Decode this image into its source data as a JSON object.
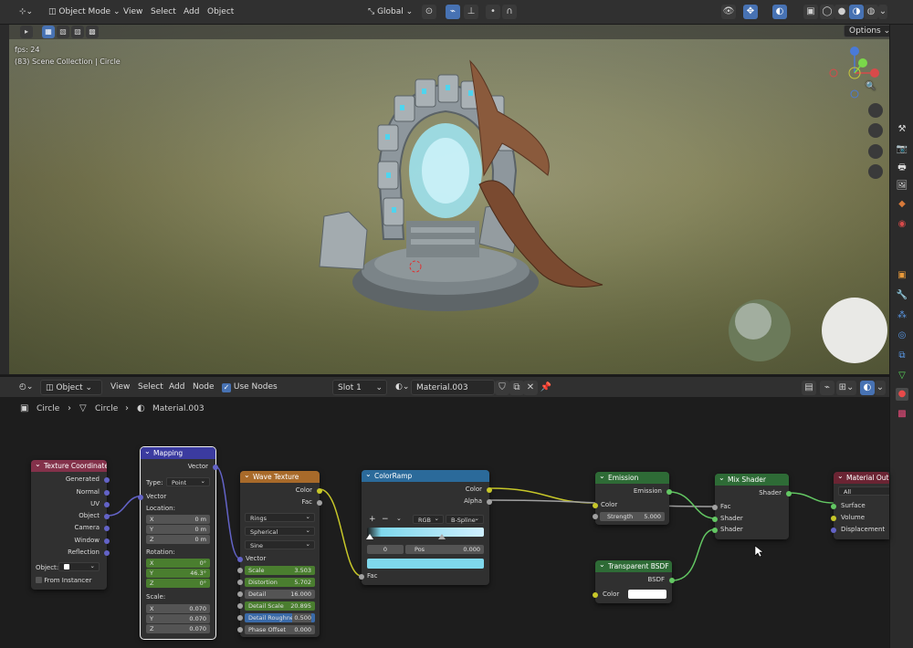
{
  "viewport_header": {
    "mode": "Object Mode",
    "menus": [
      "View",
      "Select",
      "Add",
      "Object"
    ],
    "transform_orientation": "Global",
    "options": "Options"
  },
  "viewport_overlay": {
    "fps": "fps: 24",
    "collection": "(83) Scene Collection | Circle"
  },
  "node_header": {
    "editor_type": "Object",
    "menus": [
      "View",
      "Select",
      "Add",
      "Node"
    ],
    "use_nodes": "Use Nodes",
    "slot": "Slot 1",
    "material": "Material.003"
  },
  "breadcrumb": {
    "object": "Circle",
    "mesh": "Circle",
    "material": "Material.003"
  },
  "nodes": {
    "texcoord": {
      "title": "Texture Coordinate",
      "outputs": [
        "Generated",
        "Normal",
        "UV",
        "Object",
        "Camera",
        "Window",
        "Reflection"
      ],
      "object_label": "Object:",
      "from_instancer": "From Instancer"
    },
    "mapping": {
      "title": "Mapping",
      "output": "Vector",
      "type_label": "Type:",
      "type_value": "Point",
      "input": "Vector",
      "location_label": "Location:",
      "location": [
        {
          "axis": "X",
          "value": "0 m"
        },
        {
          "axis": "Y",
          "value": "0 m"
        },
        {
          "axis": "Z",
          "value": "0 m"
        }
      ],
      "rotation_label": "Rotation:",
      "rotation": [
        {
          "axis": "X",
          "value": "0°"
        },
        {
          "axis": "Y",
          "value": "46.3°"
        },
        {
          "axis": "Z",
          "value": "0°"
        }
      ],
      "scale_label": "Scale:",
      "scale": [
        {
          "axis": "X",
          "value": "0.070"
        },
        {
          "axis": "Y",
          "value": "0.070"
        },
        {
          "axis": "Z",
          "value": "0.070"
        }
      ]
    },
    "wave": {
      "title": "Wave Texture",
      "outputs": [
        "Color",
        "Fac"
      ],
      "wave_type": "Rings",
      "direction": "Spherical",
      "profile": "Sine",
      "input": "Vector",
      "params": [
        {
          "label": "Scale",
          "value": "3.503"
        },
        {
          "label": "Distortion",
          "value": "5.702"
        },
        {
          "label": "Detail",
          "value": "16.000"
        },
        {
          "label": "Detail Scale",
          "value": "20.895"
        },
        {
          "label": "Detail Roughness",
          "value": "0.500"
        },
        {
          "label": "Phase Offset",
          "value": "0.000"
        }
      ]
    },
    "colorramp": {
      "title": "ColorRamp",
      "outputs": [
        "Color",
        "Alpha"
      ],
      "plus": "+",
      "minus": "−",
      "color_mode": "RGB",
      "interpolation": "B-Spline",
      "index": "0",
      "pos_label": "Pos",
      "pos_value": "0.000",
      "input": "Fac",
      "stop_color": "#7fd8ec"
    },
    "emission": {
      "title": "Emission",
      "output": "Emission",
      "color_label": "Color",
      "strength_label": "Strength",
      "strength_value": "5.000"
    },
    "transparent": {
      "title": "Transparent BSDF",
      "output": "BSDF",
      "color_label": "Color"
    },
    "mixshader": {
      "title": "Mix Shader",
      "output": "Shader",
      "inputs": [
        "Fac",
        "Shader",
        "Shader"
      ]
    },
    "output": {
      "title": "Material Output",
      "target": "All",
      "inputs": [
        "Surface",
        "Volume",
        "Displacement"
      ]
    }
  },
  "colors": {
    "accent": "#4772b3",
    "vector_socket": "#6363c7",
    "color_socket": "#c7c729",
    "shader_socket": "#63c763",
    "float_socket": "#a1a1a1"
  }
}
